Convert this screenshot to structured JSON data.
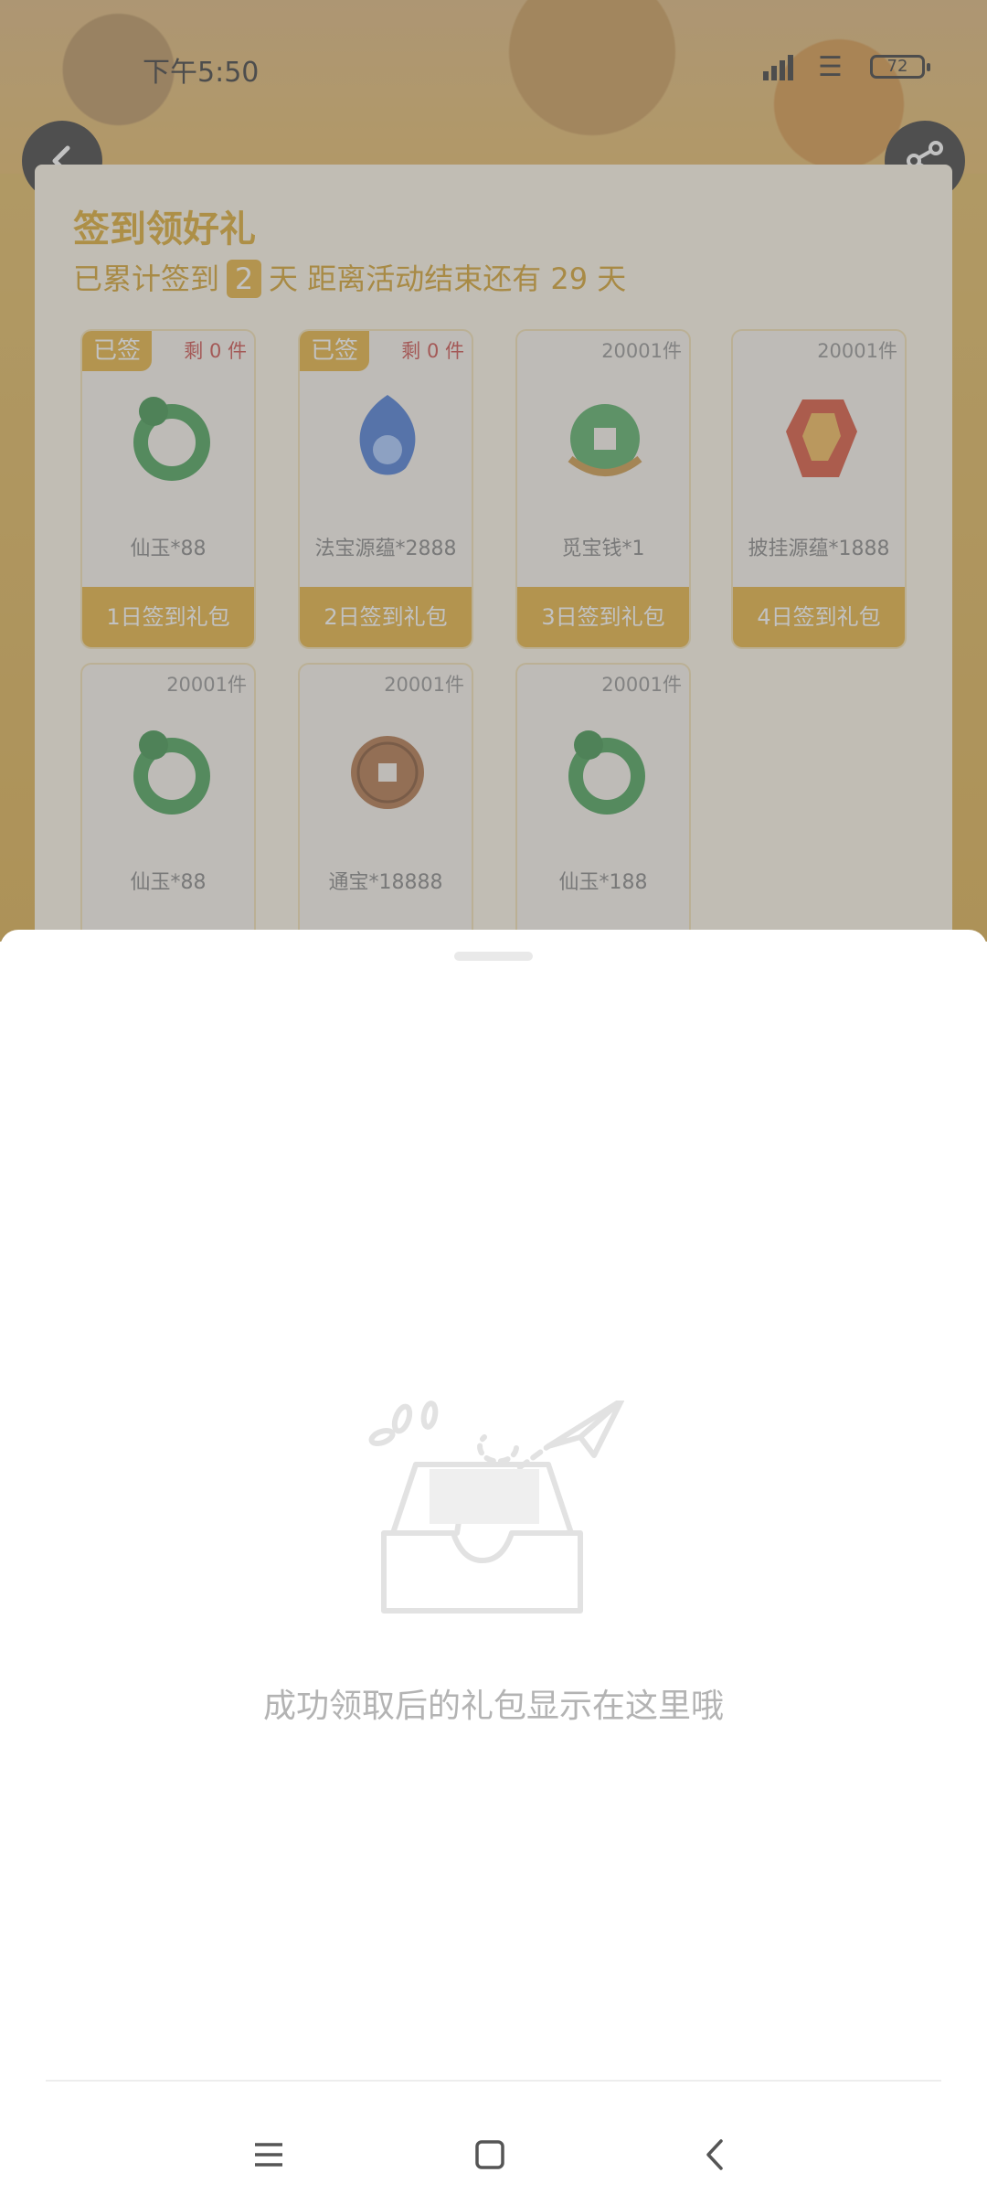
{
  "status_bar": {
    "time": "下午5:50",
    "battery": "72"
  },
  "header": {
    "back_icon": "chevron-left-icon",
    "share_icon": "share-icon"
  },
  "signin": {
    "title": "签到领好礼",
    "progress_prefix": "已累计签到",
    "days_signed": "2",
    "progress_suffix": "天  距离活动结束还有 29 天"
  },
  "gifts": [
    {
      "tag": "已签",
      "remaining": "剩 0 件",
      "count": "",
      "name": "仙玉*88",
      "button": "1日签到礼包",
      "icon": "green-dragon-ring-icon"
    },
    {
      "tag": "已签",
      "remaining": "剩 0 件",
      "count": "",
      "name": "法宝源蕴*2888",
      "button": "2日签到礼包",
      "icon": "blue-flame-gourd-icon"
    },
    {
      "tag": "",
      "remaining": "",
      "count": "20001件",
      "name": "觅宝钱*1",
      "button": "3日签到礼包",
      "icon": "jade-coin-icon"
    },
    {
      "tag": "",
      "remaining": "",
      "count": "20001件",
      "name": "披挂源蕴*1888",
      "button": "4日签到礼包",
      "icon": "red-crystal-icon"
    },
    {
      "tag": "",
      "remaining": "",
      "count": "20001件",
      "name": "仙玉*88",
      "button": "",
      "icon": "green-dragon-ring-icon"
    },
    {
      "tag": "",
      "remaining": "",
      "count": "20001件",
      "name": "通宝*18888",
      "button": "",
      "icon": "bronze-coin-icon"
    },
    {
      "tag": "",
      "remaining": "",
      "count": "20001件",
      "name": "仙玉*188",
      "button": "",
      "icon": "green-dragon-ring-icon"
    }
  ],
  "sheet": {
    "empty_text": "成功领取后的礼包显示在这里哦",
    "illustration": "empty-inbox-paper-plane-icon"
  },
  "nav": {
    "menu_icon": "menu-icon",
    "home_icon": "home-square-icon",
    "back_icon": "back-triangle-icon"
  }
}
